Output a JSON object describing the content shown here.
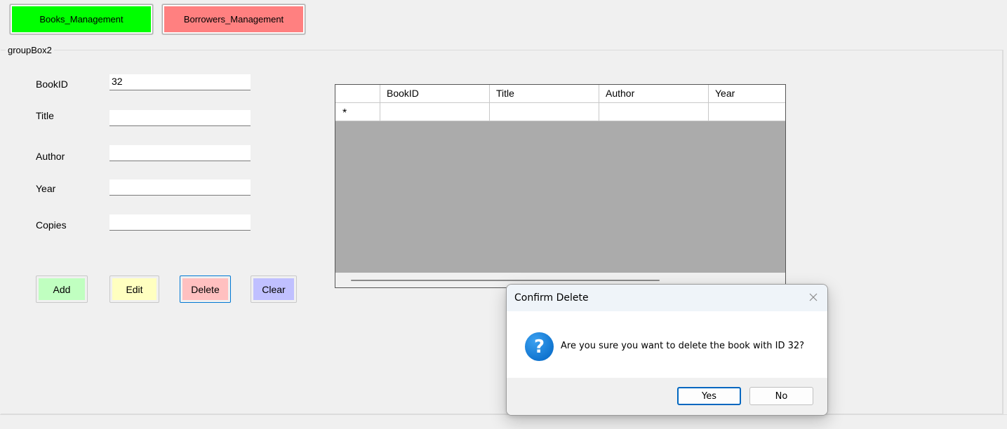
{
  "tabs": {
    "books": {
      "label": "Books_Management",
      "color": "#00ff00"
    },
    "borrowers": {
      "label": "Borrowers_Management",
      "color": "#ff8080"
    }
  },
  "groupbox": {
    "title": "groupBox2"
  },
  "form": {
    "bookid": {
      "label": "BookID",
      "value": "32"
    },
    "title": {
      "label": "Title",
      "value": ""
    },
    "author": {
      "label": "Author",
      "value": ""
    },
    "year": {
      "label": "Year",
      "value": ""
    },
    "copies": {
      "label": "Copies",
      "value": ""
    }
  },
  "actions": {
    "add": {
      "label": "Add",
      "color": "#c0ffc0"
    },
    "edit": {
      "label": "Edit",
      "color": "#ffffc0"
    },
    "delete": {
      "label": "Delete",
      "color": "#ffc0c0"
    },
    "clear": {
      "label": "Clear",
      "color": "#c0c0ff"
    }
  },
  "grid": {
    "columns": [
      "BookID",
      "Title",
      "Author",
      "Year"
    ],
    "new_row_marker": "*"
  },
  "dialog": {
    "title": "Confirm Delete",
    "icon": "question-icon",
    "icon_glyph": "?",
    "message": "Are you sure you want to delete the book with ID 32?",
    "yes_label": "Yes",
    "no_label": "No"
  }
}
